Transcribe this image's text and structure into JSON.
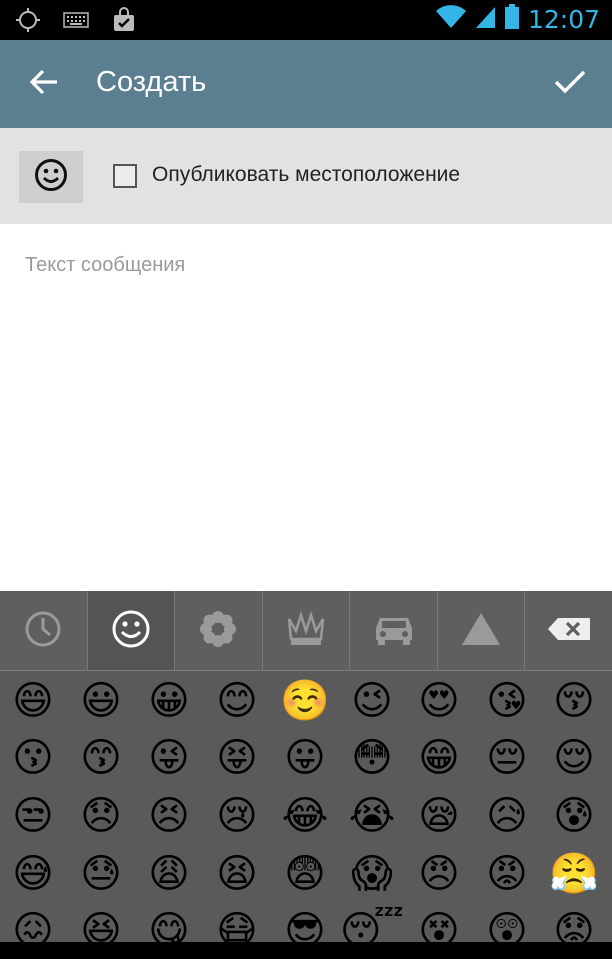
{
  "status_bar": {
    "time": "12:07",
    "icons": [
      "gps-icon",
      "keyboard-icon",
      "shopping-bag-icon",
      "wifi-icon",
      "signal-icon",
      "battery-icon"
    ]
  },
  "app_bar": {
    "title": "Создать",
    "back_icon": "arrow-left-icon",
    "confirm_icon": "checkmark-icon",
    "background": "#5b7f91"
  },
  "options": {
    "emoji_button_icon": "smiley-icon",
    "publish_location_label": "Опубликовать местоположение",
    "publish_location_checked": false
  },
  "compose": {
    "placeholder": "Текст сообщения"
  },
  "emoji_keyboard": {
    "tabs": [
      {
        "name": "recent",
        "icon": "clock-icon",
        "active": false
      },
      {
        "name": "people",
        "icon": "smiley-icon",
        "active": true
      },
      {
        "name": "nature",
        "icon": "flower-icon",
        "active": false
      },
      {
        "name": "objects",
        "icon": "crown-icon",
        "active": false
      },
      {
        "name": "places",
        "icon": "car-icon",
        "active": false
      },
      {
        "name": "symbols",
        "icon": "triangle-icon",
        "active": false
      }
    ],
    "backspace_icon": "backspace-icon",
    "emojis": [
      [
        "😄",
        "😃",
        "😀",
        "😊",
        "☺️",
        "😉",
        "😍",
        "😘",
        "😚"
      ],
      [
        "😗",
        "😙",
        "😜",
        "😝",
        "😛",
        "😳",
        "😁",
        "😔",
        "😌"
      ],
      [
        "😒",
        "😞",
        "😣",
        "😢",
        "😂",
        "😭",
        "😪",
        "😥",
        "😰"
      ],
      [
        "😅",
        "😓",
        "😩",
        "😫",
        "😨",
        "😱",
        "😠",
        "😡",
        "😤"
      ],
      [
        "😖",
        "😆",
        "😋",
        "😷",
        "😎",
        "😴",
        "😵",
        "😲",
        "😟"
      ]
    ]
  }
}
